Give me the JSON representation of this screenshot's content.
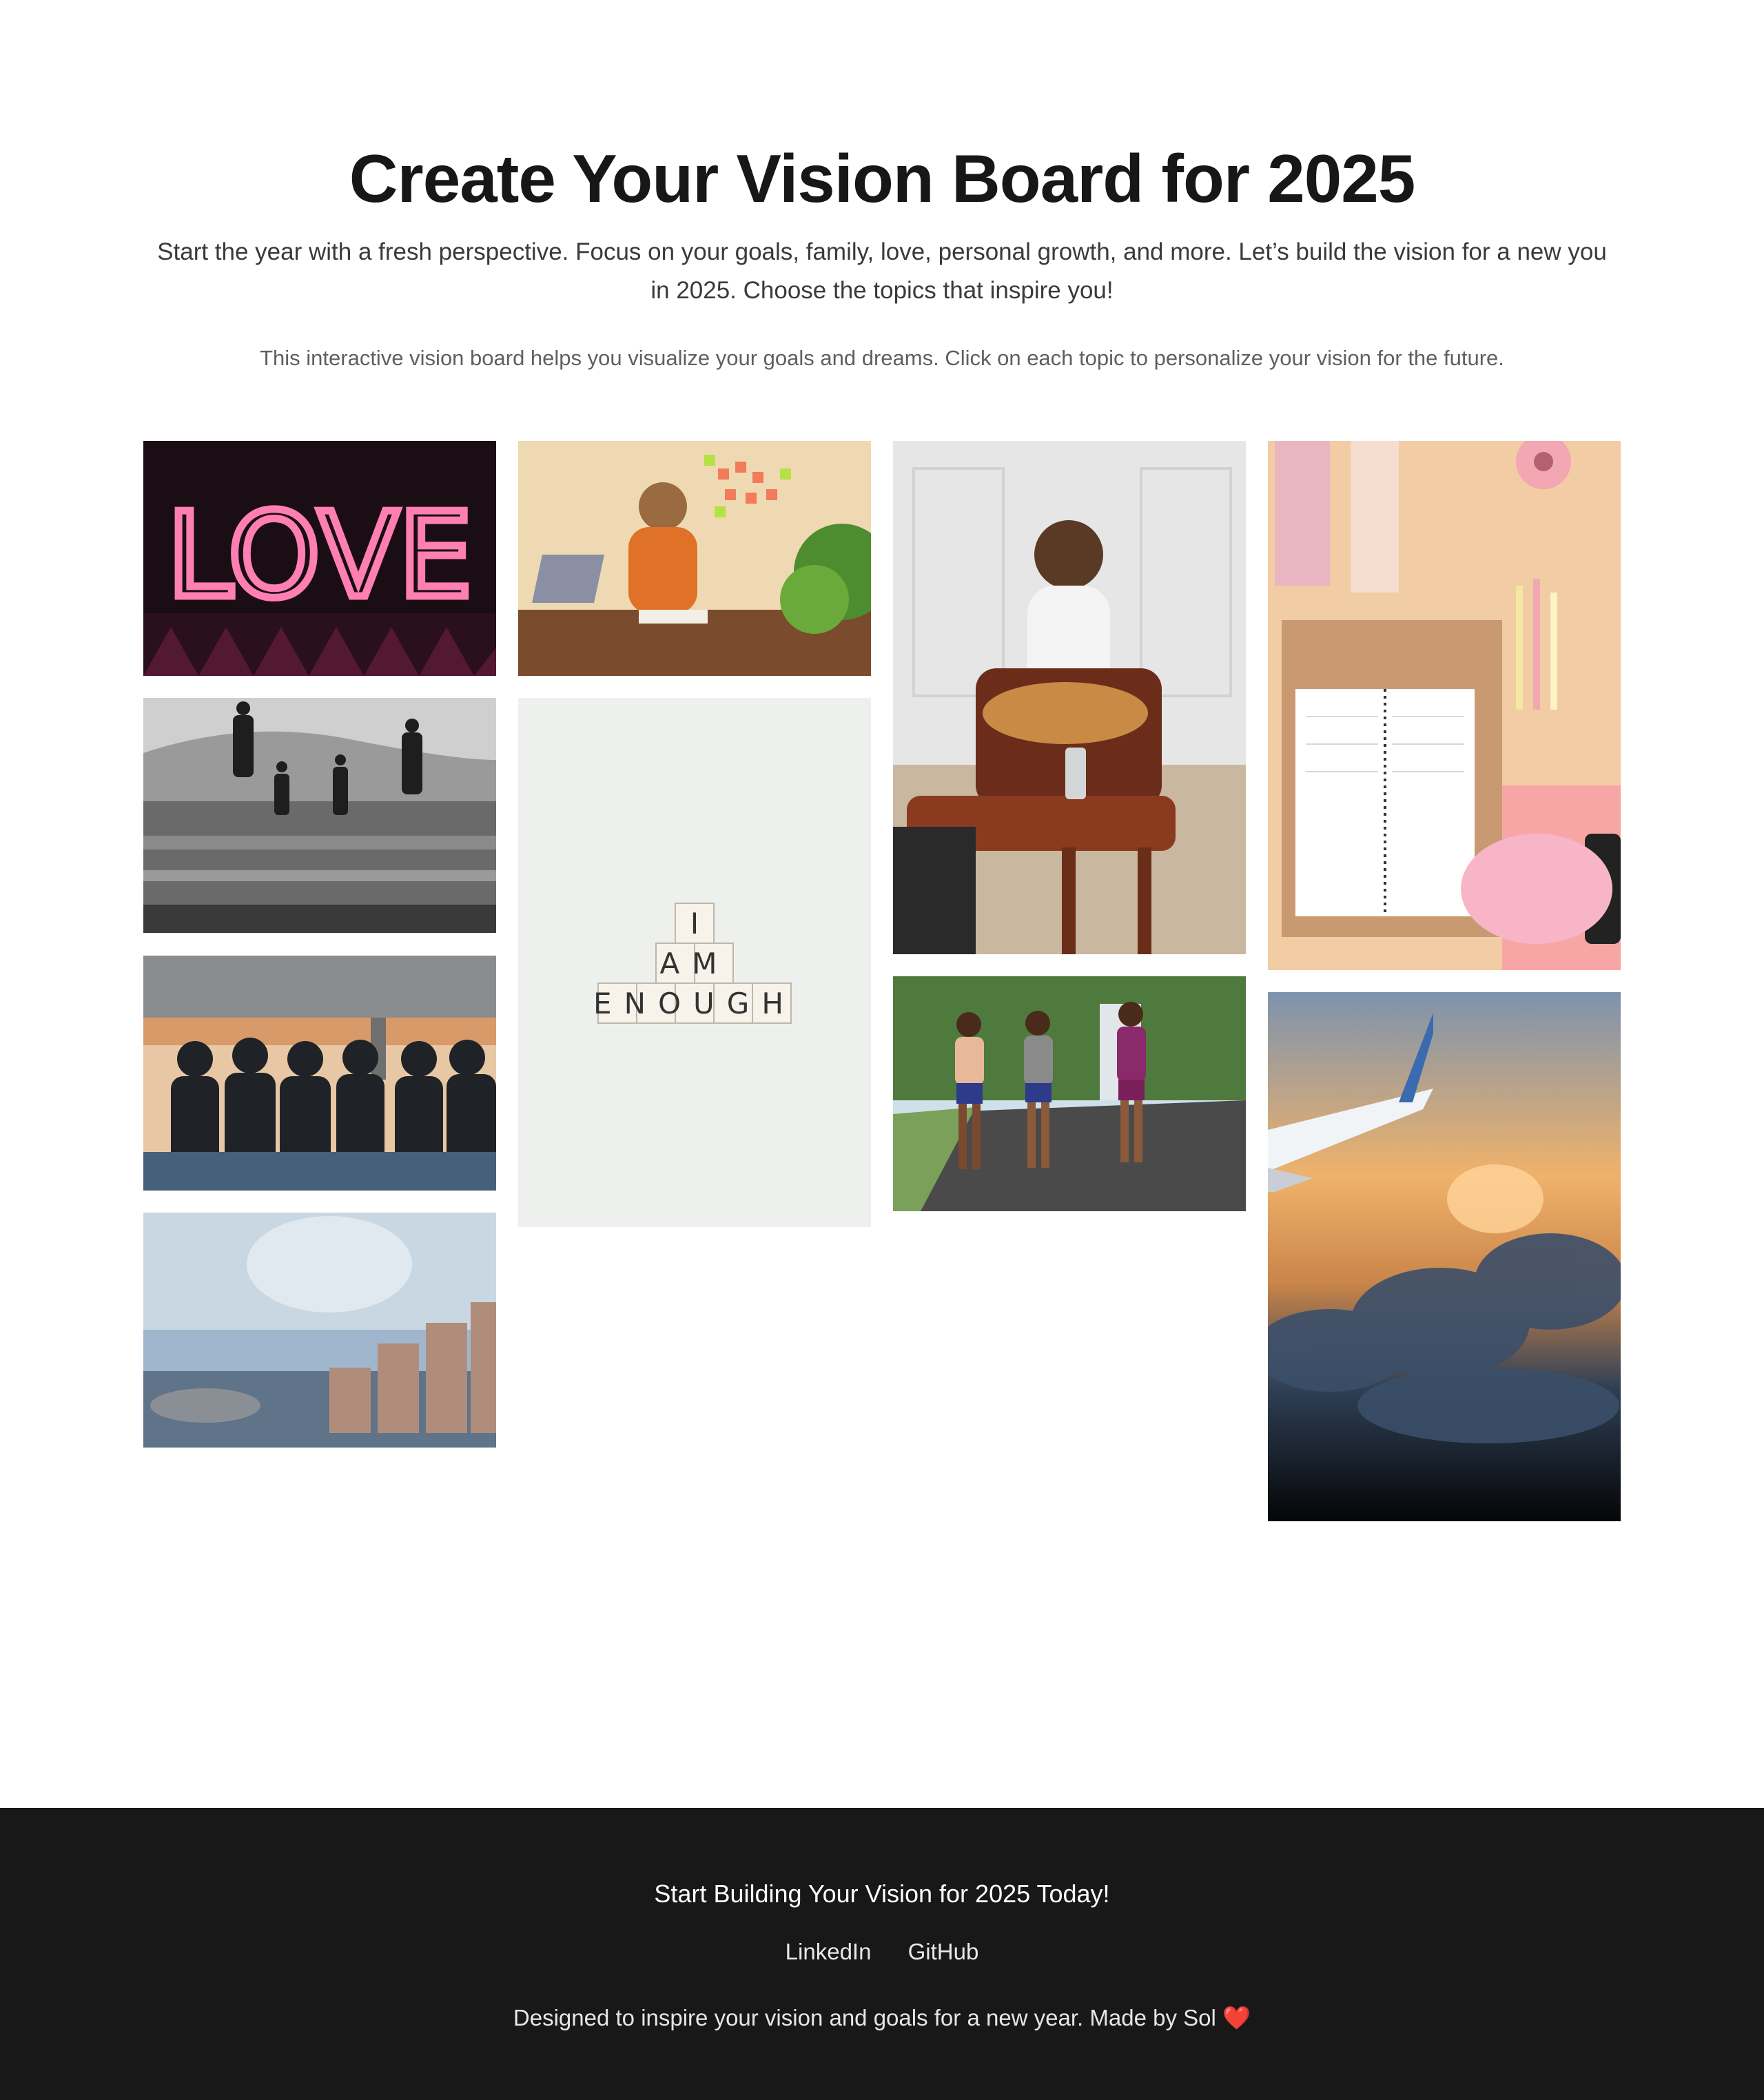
{
  "header": {
    "title": "Create Your Vision Board for 2025",
    "intro": "Start the year with a fresh perspective. Focus on your goals, family, love, personal growth, and more. Let’s build the vision for a new you in 2025. Choose the topics that inspire you!",
    "help": "This interactive vision board helps you visualize your goals and dreams. Click on each topic to personalize your vision for the future."
  },
  "tiles": {
    "love": {
      "word": "LOVE"
    },
    "enough": {
      "line1": "I",
      "line2": "AM",
      "line3": "ENOUGH"
    }
  },
  "footer": {
    "cta": "Start Building Your Vision for 2025 Today!",
    "links": [
      "LinkedIn",
      "GitHub"
    ],
    "credit": "Designed to inspire your vision and goals for a new year. Made by Sol",
    "heart": "❤️"
  },
  "colors": {
    "footer_bg": "#181818",
    "title": "#171717"
  }
}
